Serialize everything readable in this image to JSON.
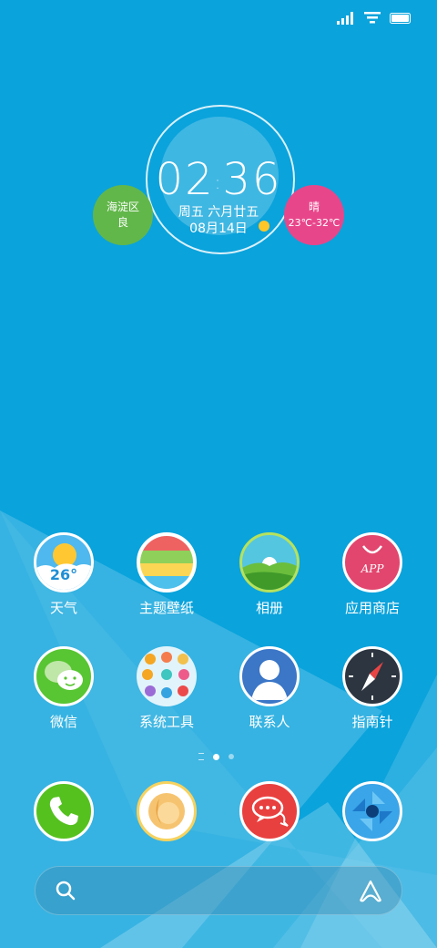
{
  "status": {
    "icons": [
      "signal-icon",
      "wifi-icon",
      "battery-icon"
    ]
  },
  "clock": {
    "time_h": "02",
    "time_m": "36",
    "date_line": "周五 六月廿五",
    "date_short": "08月14日"
  },
  "widgets": {
    "location": {
      "district": "海淀区",
      "air": "良"
    },
    "weather": {
      "condition": "晴",
      "range": "23℃-32℃"
    }
  },
  "apps_row1": [
    {
      "label": "天气",
      "icon": "weather-icon",
      "badge": "26°"
    },
    {
      "label": "主题壁纸",
      "icon": "theme-wallpaper-icon"
    },
    {
      "label": "相册",
      "icon": "album-icon"
    },
    {
      "label": "应用商店",
      "icon": "app-store-icon",
      "badge": "APP"
    }
  ],
  "apps_row2": [
    {
      "label": "微信",
      "icon": "wechat-icon"
    },
    {
      "label": "系统工具",
      "icon": "system-tools-folder-icon"
    },
    {
      "label": "联系人",
      "icon": "contacts-icon"
    },
    {
      "label": "指南针",
      "icon": "compass-icon"
    }
  ],
  "dock": [
    {
      "icon": "phone-icon"
    },
    {
      "icon": "browser-icon"
    },
    {
      "icon": "messages-icon"
    },
    {
      "icon": "camera-icon"
    }
  ],
  "search": {
    "icon": "search-icon",
    "assistant_icon": "assistant-icon"
  },
  "colors": {
    "background": "#0aa3dc",
    "green": "#62b74a",
    "pink": "#e8468b"
  }
}
